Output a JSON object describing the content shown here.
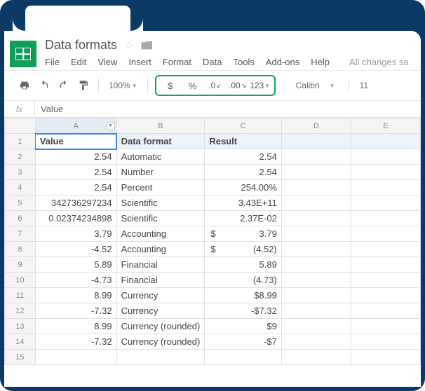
{
  "doc": {
    "title": "Data formats",
    "changes": "All changes sa"
  },
  "menu": {
    "file": "File",
    "edit": "Edit",
    "view": "View",
    "insert": "Insert",
    "format": "Format",
    "data": "Data",
    "tools": "Tools",
    "addons": "Add-ons",
    "help": "Help"
  },
  "toolbar": {
    "zoom": "100%",
    "currency": "$",
    "percent": "%",
    "decdec": ".0",
    "incdec": ".00",
    "more": "123",
    "font": "Calibri",
    "size": "11"
  },
  "fx": {
    "value": "Value"
  },
  "cols": {
    "A": "A",
    "B": "B",
    "C": "C",
    "D": "D",
    "E": "E"
  },
  "hdr": {
    "value": "Value",
    "fmt": "Data format",
    "result": "Result"
  },
  "rows": [
    {
      "n": "1"
    },
    {
      "n": "2",
      "v": "2.54",
      "f": "Automatic",
      "r": "2.54"
    },
    {
      "n": "3",
      "v": "2.54",
      "f": "Number",
      "r": "2.54"
    },
    {
      "n": "4",
      "v": "2.54",
      "f": "Percent",
      "r": "254.00%"
    },
    {
      "n": "5",
      "v": "342736297234",
      "f": "Scientific",
      "r": "3.43E+11"
    },
    {
      "n": "6",
      "v": "0.02374234898",
      "f": "Scientific",
      "r": "2.37E-02"
    },
    {
      "n": "7",
      "v": "3.79",
      "f": "Accounting",
      "rsym": "$",
      "rval": "3.79"
    },
    {
      "n": "8",
      "v": "-4.52",
      "f": "Accounting",
      "rsym": "$",
      "rval": "(4.52)"
    },
    {
      "n": "9",
      "v": "5.89",
      "f": "Financial",
      "r": "5.89"
    },
    {
      "n": "10",
      "v": "-4.73",
      "f": "Financial",
      "r": "(4.73)"
    },
    {
      "n": "11",
      "v": "8.99",
      "f": "Currency",
      "r": "$8.99"
    },
    {
      "n": "12",
      "v": "-7.32",
      "f": "Currency",
      "r": "-$7.32"
    },
    {
      "n": "13",
      "v": "8.99",
      "f": "Currency (rounded)",
      "r": "$9"
    },
    {
      "n": "14",
      "v": "-7.32",
      "f": "Currency (rounded)",
      "r": "-$7"
    },
    {
      "n": "15"
    }
  ]
}
